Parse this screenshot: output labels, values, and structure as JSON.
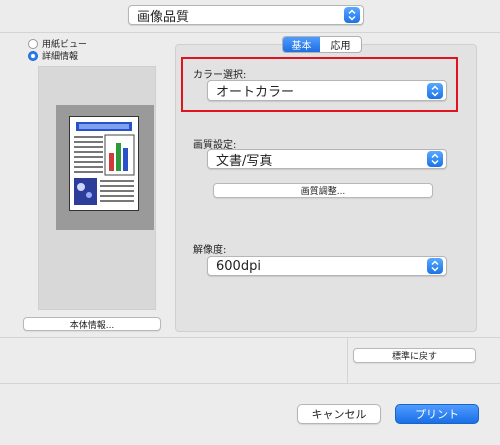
{
  "header": {
    "preset_value": "画像品質"
  },
  "left": {
    "view_options": [
      {
        "label": "用紙ビュー",
        "selected": false
      },
      {
        "label": "詳細情報",
        "selected": true
      }
    ],
    "device_info_button": "本体情報..."
  },
  "tabs": [
    {
      "label": "基本",
      "active": true
    },
    {
      "label": "応用",
      "active": false
    }
  ],
  "settings": {
    "color_label": "カラー選択:",
    "color_value": "オートカラー",
    "quality_label": "画質設定:",
    "quality_value": "文書/写真",
    "quality_adjust_button": "画質調整...",
    "resolution_label": "解像度:",
    "resolution_value": "600dpi"
  },
  "reset_button": "標準に戻す",
  "footer": {
    "cancel_label": "キャンセル",
    "print_label": "プリント"
  },
  "colors": {
    "accent": "#1a73e8",
    "highlight_border": "#e0141e"
  },
  "icons": [
    "popup-stepper-icon",
    "document-preview-icon"
  ]
}
